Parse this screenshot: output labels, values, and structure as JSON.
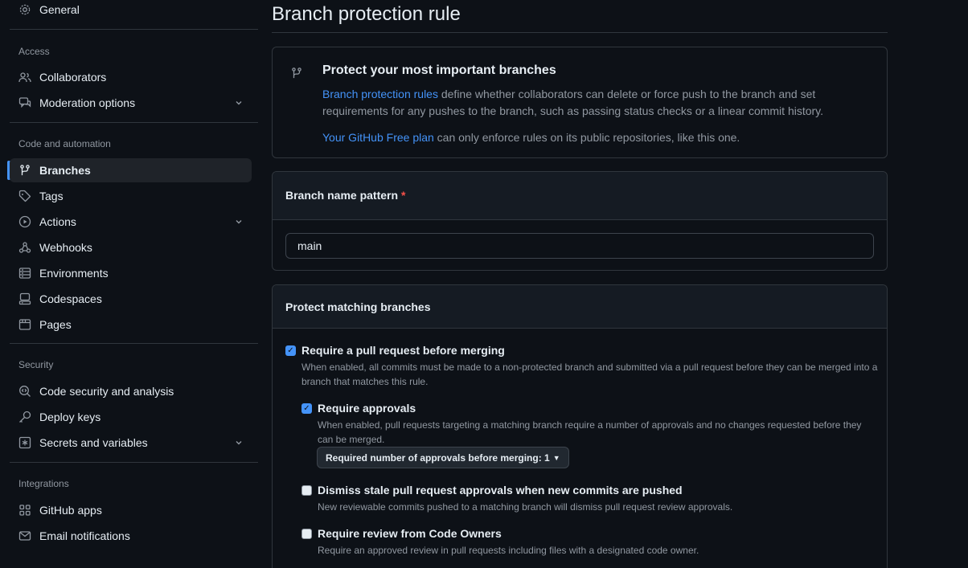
{
  "sidebar": {
    "general": "General",
    "sections": {
      "access": "Access",
      "code": "Code and automation",
      "security": "Security",
      "integrations": "Integrations"
    },
    "items": {
      "collaborators": "Collaborators",
      "moderation": "Moderation options",
      "branches": "Branches",
      "tags": "Tags",
      "actions": "Actions",
      "webhooks": "Webhooks",
      "environments": "Environments",
      "codespaces": "Codespaces",
      "pages": "Pages",
      "code_security": "Code security and analysis",
      "deploy_keys": "Deploy keys",
      "secrets": "Secrets and variables",
      "github_apps": "GitHub apps",
      "email": "Email notifications"
    }
  },
  "main": {
    "title": "Branch protection rule",
    "info": {
      "heading": "Protect your most important branches",
      "link1": "Branch protection rules",
      "text1": " define whether collaborators can delete or force push to the branch and set requirements for any pushes to the branch, such as passing status checks or a linear commit history.",
      "link2": "Your GitHub Free plan",
      "text2": " can only enforce rules on its public repositories, like this one."
    },
    "pattern": {
      "label": "Branch name pattern",
      "required_mark": "*",
      "value": "main"
    },
    "protect": {
      "header": "Protect matching branches",
      "require_pr": {
        "label": "Require a pull request before merging",
        "desc": "When enabled, all commits must be made to a non-protected branch and submitted via a pull request before they can be merged into a branch that matches this rule.",
        "checked": true
      },
      "require_approvals": {
        "label": "Require approvals",
        "desc": "When enabled, pull requests targeting a matching branch require a number of approvals and no changes requested before they can be merged.",
        "checked": true
      },
      "approvals_select": "Required number of approvals before merging: 1",
      "dismiss_stale": {
        "label": "Dismiss stale pull request approvals when new commits are pushed",
        "desc": "New reviewable commits pushed to a matching branch will dismiss pull request review approvals.",
        "checked": false
      },
      "code_owners": {
        "label": "Require review from Code Owners",
        "desc": "Require an approved review in pull requests including files with a designated code owner.",
        "checked": false
      }
    }
  },
  "colors": {
    "bg": "#0d1117",
    "border": "#30363d",
    "accent": "#4493f8",
    "muted": "#9198a1",
    "danger": "#f85149"
  }
}
